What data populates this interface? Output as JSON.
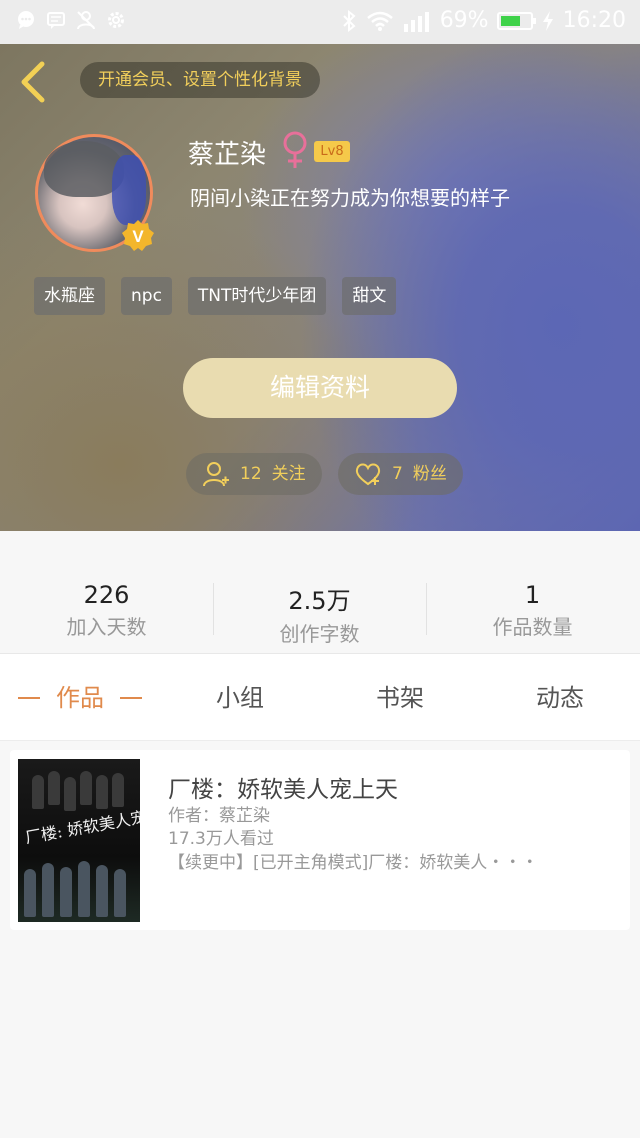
{
  "status_bar": {
    "battery_text": "69%",
    "battery_level": 0.69,
    "time": "16:20",
    "left_icons": [
      "chat-bubble-icon",
      "message-icon",
      "person-off-icon",
      "settings-icon"
    ],
    "right_icons": [
      "bluetooth-icon",
      "wifi-icon",
      "signal-icon",
      "battery-icon",
      "charging-icon"
    ]
  },
  "header": {
    "back_icon": "chevron-left-icon",
    "vip_prompt": "开通会员、设置个性化背景",
    "name": "蔡芷染",
    "gender_icon": "female-icon",
    "level": "Lv8",
    "signature": "阴间小染正在努力成为你想要的样子",
    "verified_badge": "V",
    "tags": [
      "水瓶座",
      "npc",
      "TNT时代少年团",
      "甜文"
    ],
    "edit_button": "编辑资料",
    "following_count": "12",
    "following_label": "关注",
    "fans_count": "7",
    "fans_label": "粉丝"
  },
  "stats": [
    {
      "value": "226",
      "label": "加入天数"
    },
    {
      "value": "2.5万",
      "label": "创作字数"
    },
    {
      "value": "1",
      "label": "作品数量"
    }
  ],
  "tabs": [
    {
      "label": "作品",
      "active": true
    },
    {
      "label": "小组",
      "active": false
    },
    {
      "label": "书架",
      "active": false
    },
    {
      "label": "动态",
      "active": false
    }
  ],
  "book": {
    "cover_title": "厂楼: 娇软美人宠上天",
    "title": "厂楼：娇软美人宠上天",
    "author": "作者：蔡芷染",
    "views": "17.3万人看过",
    "description": "【续更中】[已开主角模式]厂楼：娇软美人・・・"
  },
  "colors": {
    "accent": "#e08a4c",
    "gold": "#f2cf5b",
    "edit_button": "#e9dcb0",
    "level_badge": "#f5c94a"
  }
}
